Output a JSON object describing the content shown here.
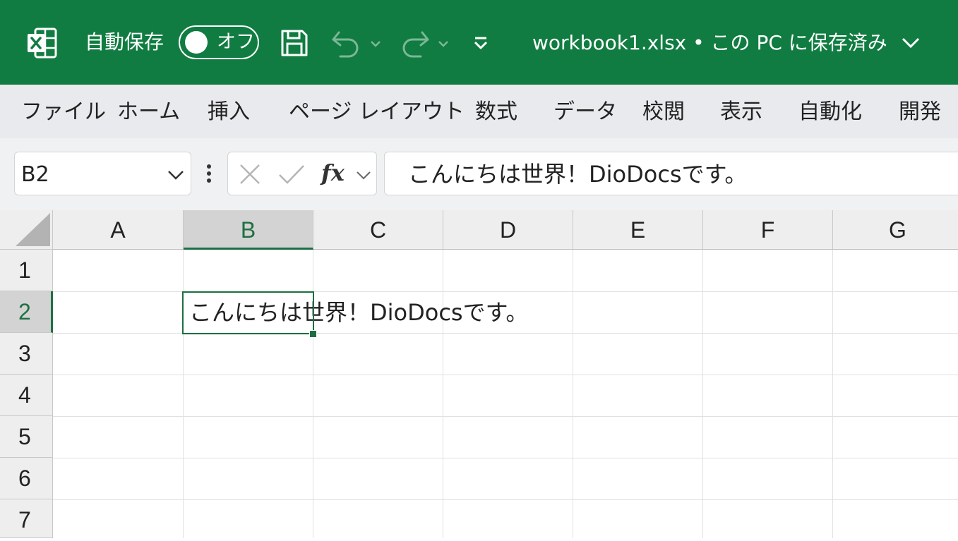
{
  "titlebar": {
    "autosave_label": "自動保存",
    "autosave_toggle": "オフ",
    "workbook_title": "workbook1.xlsx • この PC に保存済み",
    "icons": [
      "excel-logo-icon",
      "save-icon",
      "undo-icon",
      "redo-icon",
      "customize-quick-access-icon",
      "chevron-down-icon"
    ]
  },
  "ribbon": {
    "tabs": [
      "ファイル",
      "ホーム",
      "挿入",
      "ページ レイアウト",
      "数式",
      "データ",
      "校閲",
      "表示",
      "自動化",
      "開発"
    ]
  },
  "formula_bar": {
    "name_box": "B2",
    "fx_label": "fx",
    "formula": "こんにちは世界！DioDocsです。"
  },
  "grid": {
    "columns": [
      "A",
      "B",
      "C",
      "D",
      "E",
      "F",
      "G"
    ],
    "rows": [
      "1",
      "2",
      "3",
      "4",
      "5",
      "6",
      "7"
    ],
    "active_column": "B",
    "active_row": "2",
    "cell_b2": "こんにちは世界！DioDocsです。"
  },
  "colors": {
    "titlebar_bg": "#107c41",
    "accent": "#1d6f42",
    "ribbon_bg": "#e8eaed",
    "header_bg": "#eeeeee"
  }
}
